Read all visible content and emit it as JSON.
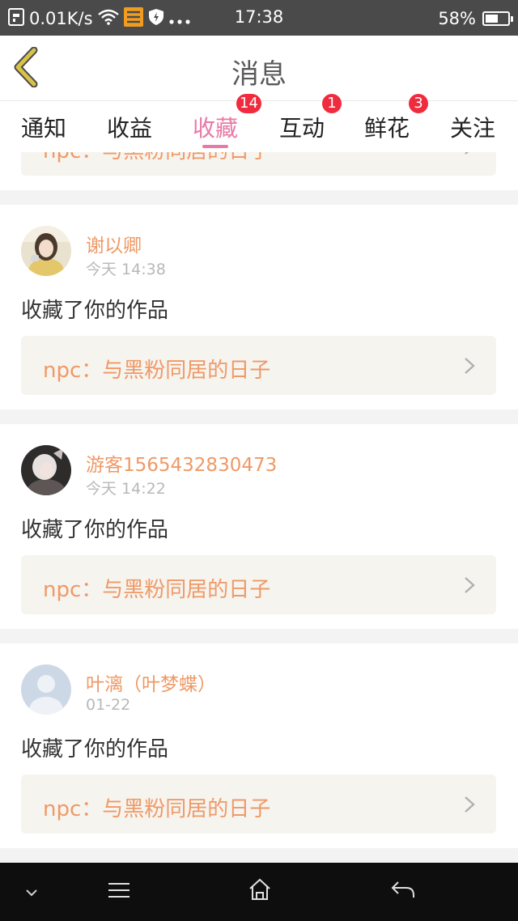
{
  "status_bar": {
    "speed": "0.01K/s",
    "time": "17:38",
    "battery": "58%",
    "battery_level": 0.58
  },
  "header": {
    "title": "消息"
  },
  "tabs": [
    {
      "label": "通知",
      "badge": ""
    },
    {
      "label": "收益",
      "badge": ""
    },
    {
      "label": "收藏",
      "badge": "14",
      "active": true
    },
    {
      "label": "互动",
      "badge": "1"
    },
    {
      "label": "鲜花",
      "badge": "3"
    },
    {
      "label": "关注",
      "badge": ""
    }
  ],
  "partial_item": {
    "work_title": "npc：与黑粉同居的日子"
  },
  "messages": [
    {
      "user": "谢以卿",
      "time": "今天 14:38",
      "action": "收藏了你的作品",
      "work_title": "npc：与黑粉同居的日子"
    },
    {
      "user": "游客1565432830473",
      "time": "今天 14:22",
      "action": "收藏了你的作品",
      "work_title": "npc：与黑粉同居的日子"
    },
    {
      "user": "叶漓（叶梦蝶）",
      "time": "01-22",
      "action": "收藏了你的作品",
      "work_title": "npc：与黑粉同居的日子"
    }
  ],
  "icons": {
    "back": "chevron-left-icon",
    "work": "chevron-right-icon"
  },
  "colors": {
    "accent": "#e879a6",
    "name": "#ef9966",
    "badge": "#f02b3e",
    "back": "#d8c24a"
  }
}
